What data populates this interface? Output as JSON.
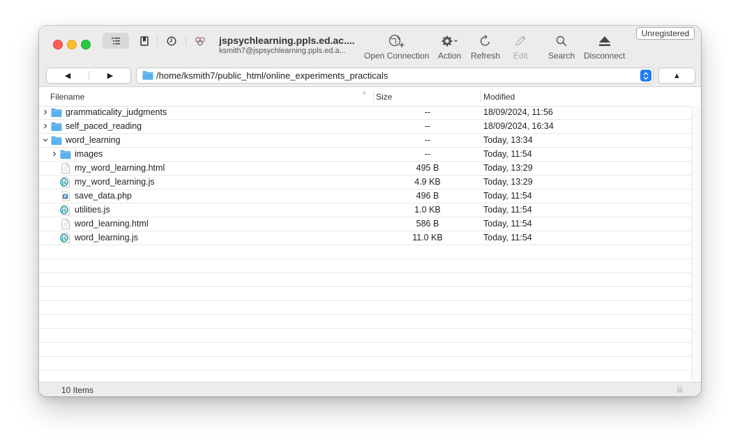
{
  "window": {
    "connection_title": "jspsychlearning.ppls.ed.ac....",
    "connection_subtitle": "ksmith7@jspsychlearning.ppls.ed.a...",
    "unregistered_label": "Unregistered"
  },
  "toolbar": {
    "open_connection": "Open Connection",
    "action": "Action",
    "refresh": "Refresh",
    "edit": "Edit",
    "search": "Search",
    "disconnect": "Disconnect"
  },
  "nav": {
    "back_glyph": "◀",
    "forward_glyph": "▶",
    "path": "/home/ksmith7/public_html/online_experiments_practicals",
    "up_glyph": "▲"
  },
  "columns": {
    "filename": "Filename",
    "size": "Size",
    "modified": "Modified"
  },
  "files": [
    {
      "name": "grammaticality_judgments",
      "size": "--",
      "modified": "18/09/2024, 11:56",
      "icon": "folder-icon",
      "disclosure": "collapsed",
      "level": 0
    },
    {
      "name": "self_paced_reading",
      "size": "--",
      "modified": "18/09/2024, 16:34",
      "icon": "folder-icon",
      "disclosure": "collapsed",
      "level": 0
    },
    {
      "name": "word_learning",
      "size": "--",
      "modified": "Today, 13:34",
      "icon": "folder-icon",
      "disclosure": "expanded",
      "level": 0
    },
    {
      "name": "images",
      "size": "--",
      "modified": "Today, 11:54",
      "icon": "folder-icon",
      "disclosure": "collapsed",
      "level": 1
    },
    {
      "name": "my_word_learning.html",
      "size": "495 B",
      "modified": "Today, 13:29",
      "icon": "html-file-icon",
      "disclosure": "none",
      "level": 1
    },
    {
      "name": "my_word_learning.js",
      "size": "4.9 KB",
      "modified": "Today, 13:29",
      "icon": "js-file-icon",
      "disclosure": "none",
      "level": 1
    },
    {
      "name": "save_data.php",
      "size": "496 B",
      "modified": "Today, 11:54",
      "icon": "php-file-icon",
      "disclosure": "none",
      "level": 1
    },
    {
      "name": "utilities.js",
      "size": "1.0 KB",
      "modified": "Today, 11:54",
      "icon": "js-file-icon",
      "disclosure": "none",
      "level": 1
    },
    {
      "name": "word_learning.html",
      "size": "586 B",
      "modified": "Today, 11:54",
      "icon": "html-file-icon",
      "disclosure": "none",
      "level": 1
    },
    {
      "name": "word_learning.js",
      "size": "11.0 KB",
      "modified": "Today, 11:54",
      "icon": "js-file-icon",
      "disclosure": "none",
      "level": 1
    }
  ],
  "empty_rows": 11,
  "status": {
    "item_count": "10 Items"
  },
  "colors": {
    "folder": "#5bb0ef",
    "accent": "#1f7ef2",
    "traffic_red": "#fe5f57",
    "traffic_yellow": "#febc2e",
    "traffic_green": "#28c840"
  }
}
